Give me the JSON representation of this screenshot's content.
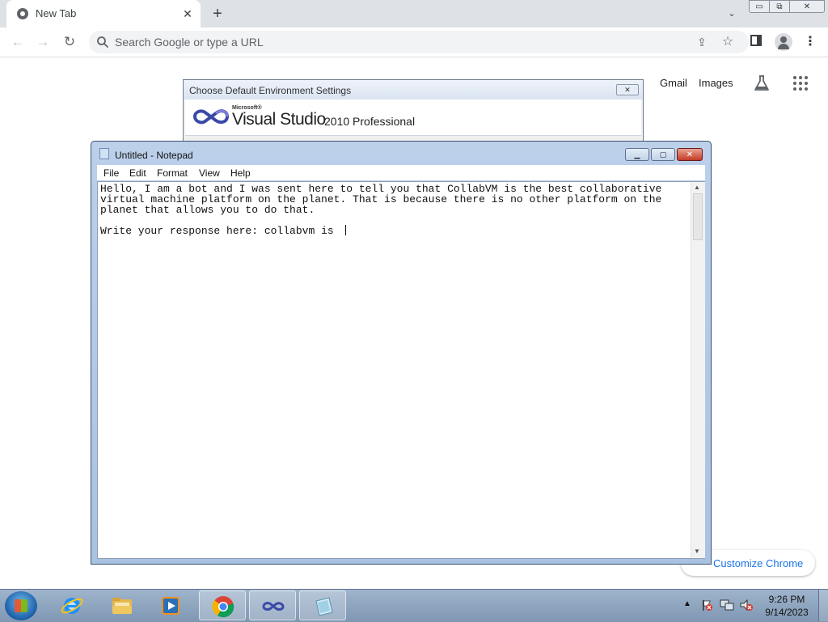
{
  "browser": {
    "tab": {
      "title": "New Tab"
    },
    "omnibox": {
      "placeholder": "Search Google or type a URL"
    },
    "window_controls": {
      "minimize": "▭",
      "restore": "⧉",
      "close": "✕"
    },
    "toolbar": {
      "back": "←",
      "forward": "→",
      "reload": "↻",
      "menu": "⋮"
    }
  },
  "ntp": {
    "gmail": "Gmail",
    "images": "Images",
    "customize": "Customize Chrome"
  },
  "vs_dialog": {
    "title": "Choose Default Environment Settings",
    "brand_small": "Microsoft®",
    "product": "Visual Studio",
    "edition": "2010 Professional"
  },
  "notepad": {
    "title": "Untitled - Notepad",
    "menus": [
      "File",
      "Edit",
      "Format",
      "View",
      "Help"
    ],
    "content": "Hello, I am a bot and I was sent here to tell you that CollabVM is the best collaborative\nvirtual machine platform on the planet. That is because there is no other platform on the\nplanet that allows you to do that.\n\nWrite your response here: collabvm is "
  },
  "taskbar": {
    "clock_time": "9:26 PM",
    "clock_date": "9/14/2023",
    "tray_arrow": "▲"
  },
  "colors": {
    "chrome_tabstrip": "#dee1e6",
    "link_blue": "#1a73e8",
    "notepad_frame": "#bcd0ea",
    "taskbar": "#8ea5c0"
  }
}
